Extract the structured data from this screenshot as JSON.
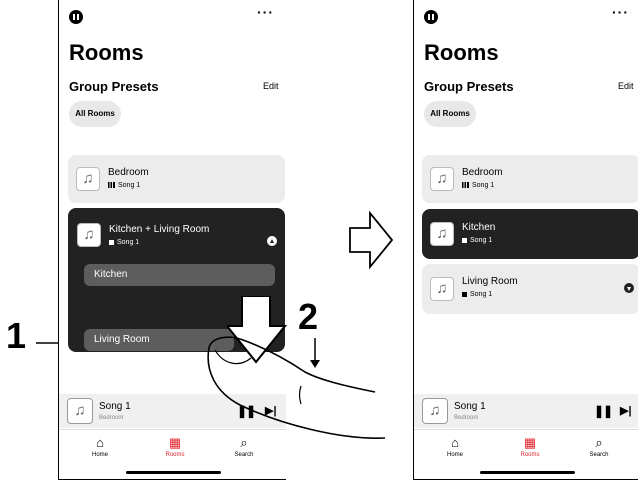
{
  "callouts": {
    "step1": "1",
    "step2": "2"
  },
  "left": {
    "title": "Rooms",
    "more": "···",
    "group_presets": "Group Presets",
    "edit": "Edit",
    "all_rooms": "All Rooms",
    "bedroom": {
      "name": "Bedroom",
      "song": "Song 1"
    },
    "group": {
      "name": "Kitchen + Living Room",
      "song": "Song 1",
      "sub1": "Kitchen",
      "sub2": "Living Room"
    },
    "mini": {
      "song": "Song 1",
      "room": "Bedroom"
    },
    "tabs": {
      "home": "Home",
      "rooms": "Rooms",
      "search": "Search"
    }
  },
  "right": {
    "title": "Rooms",
    "more": "···",
    "group_presets": "Group Presets",
    "edit": "Edit",
    "all_rooms": "All Rooms",
    "bedroom": {
      "name": "Bedroom",
      "song": "Song 1"
    },
    "kitchen": {
      "name": "Kitchen",
      "song": "Song 1"
    },
    "living": {
      "name": "Living Room",
      "song": "Song 1"
    },
    "mini": {
      "song": "Song 1",
      "room": "Bedroom"
    },
    "tabs": {
      "home": "Home",
      "rooms": "Rooms",
      "search": "Search"
    }
  },
  "icons": {
    "music": "♫",
    "pause": "❚❚",
    "next": "▶|",
    "home": "⌂",
    "search": "⌕",
    "rooms": "▦"
  },
  "colors": {
    "accent": "#e0242c",
    "dark_card": "#222222",
    "sub_room": "#5d5d5d"
  }
}
